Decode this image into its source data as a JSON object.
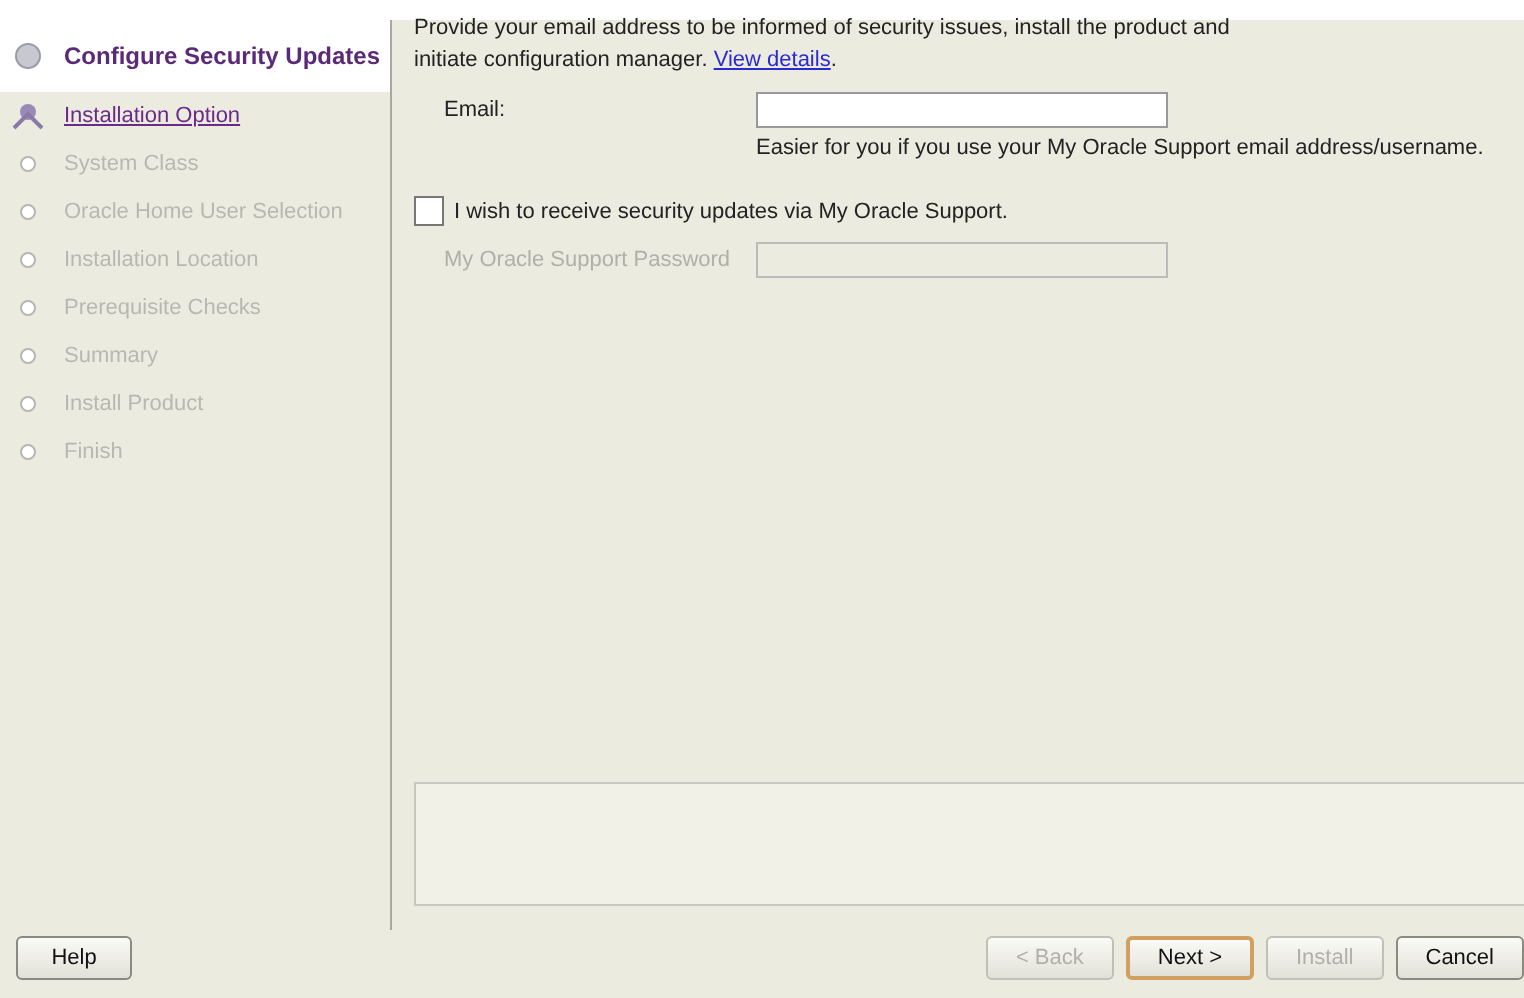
{
  "steps": [
    {
      "label": "Configure Security Updates",
      "kind": "current"
    },
    {
      "label": "Installation Option",
      "kind": "link"
    },
    {
      "label": "System Class",
      "kind": "pending"
    },
    {
      "label": "Oracle Home User Selection",
      "kind": "pending"
    },
    {
      "label": "Installation Location",
      "kind": "pending"
    },
    {
      "label": "Prerequisite Checks",
      "kind": "pending"
    },
    {
      "label": "Summary",
      "kind": "pending"
    },
    {
      "label": "Install Product",
      "kind": "pending"
    },
    {
      "label": "Finish",
      "kind": "pending"
    }
  ],
  "intro": {
    "text": "Provide your email address to be informed of security issues, install the product and initiate configuration manager.",
    "link": "View details",
    "after": "."
  },
  "email": {
    "label": "Email:",
    "hint": "Easier for you if you use your My Oracle Support email address/username."
  },
  "receive_updates": {
    "label": "I wish to receive security updates via My Oracle Support.",
    "checked": false
  },
  "password": {
    "label": "My Oracle Support Password",
    "disabled": true
  },
  "buttons": {
    "help": {
      "label": "Help",
      "disabled": false
    },
    "nav": [
      {
        "label": "< Back",
        "disabled": true,
        "default": false
      },
      {
        "label": "Next >",
        "disabled": false,
        "default": true
      },
      {
        "label": "Install",
        "disabled": true,
        "default": false
      },
      {
        "label": "Cancel",
        "disabled": false,
        "default": false
      }
    ]
  }
}
